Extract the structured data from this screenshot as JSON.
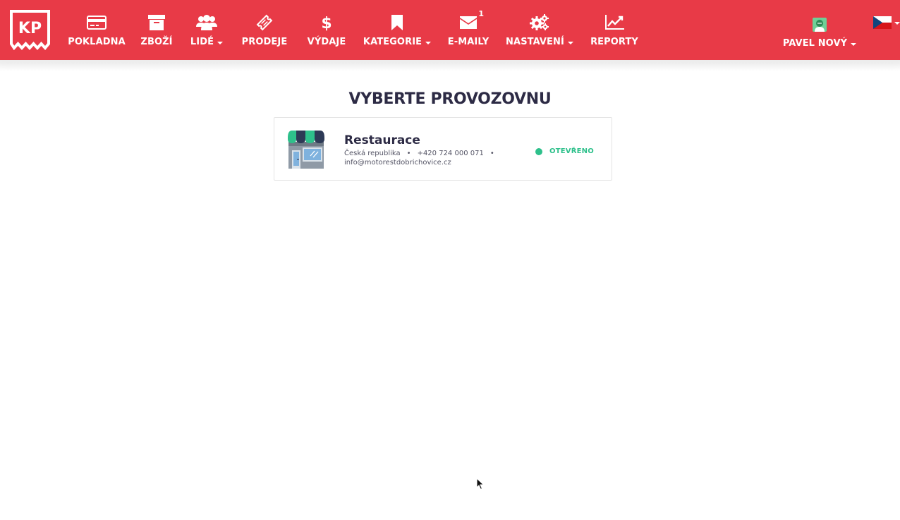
{
  "colors": {
    "brand": "#e83a47",
    "title": "#2d2b45",
    "status_open": "#2ec08b"
  },
  "logo": {
    "text": "KP",
    "icon": "kp-receipt-logo"
  },
  "nav": {
    "pokladna": {
      "label": "POKLADNA",
      "icon": "credit-card-icon"
    },
    "zbozi": {
      "label": "ZBOŽÍ",
      "icon": "archive-box-icon"
    },
    "lide": {
      "label": "LIDÉ",
      "icon": "users-icon"
    },
    "prodeje": {
      "label": "PRODEJE",
      "icon": "ticket-icon"
    },
    "vydaje": {
      "label": "VÝDAJE",
      "icon": "dollar-icon"
    },
    "kategorie": {
      "label": "KATEGORIE",
      "icon": "bookmark-icon"
    },
    "emaily": {
      "label": "E-MAILY",
      "icon": "envelope-icon",
      "badge": "1"
    },
    "nastaveni": {
      "label": "NASTAVENÍ",
      "icon": "gears-icon"
    },
    "reporty": {
      "label": "REPORTY",
      "icon": "line-chart-icon"
    }
  },
  "user": {
    "name": "PAVEL NOVÝ",
    "icon": "user-avatar-icon"
  },
  "language": {
    "icon": "czech-flag-icon"
  },
  "main": {
    "title": "VYBERTE PROVOZOVNU",
    "store": {
      "name": "Restaurace",
      "country": "Česká republika",
      "phone": "+420 724 000 071",
      "email": "info@motorestdobrichovice.cz",
      "status": "OTEVŘENO",
      "icon": "storefront-icon"
    }
  }
}
